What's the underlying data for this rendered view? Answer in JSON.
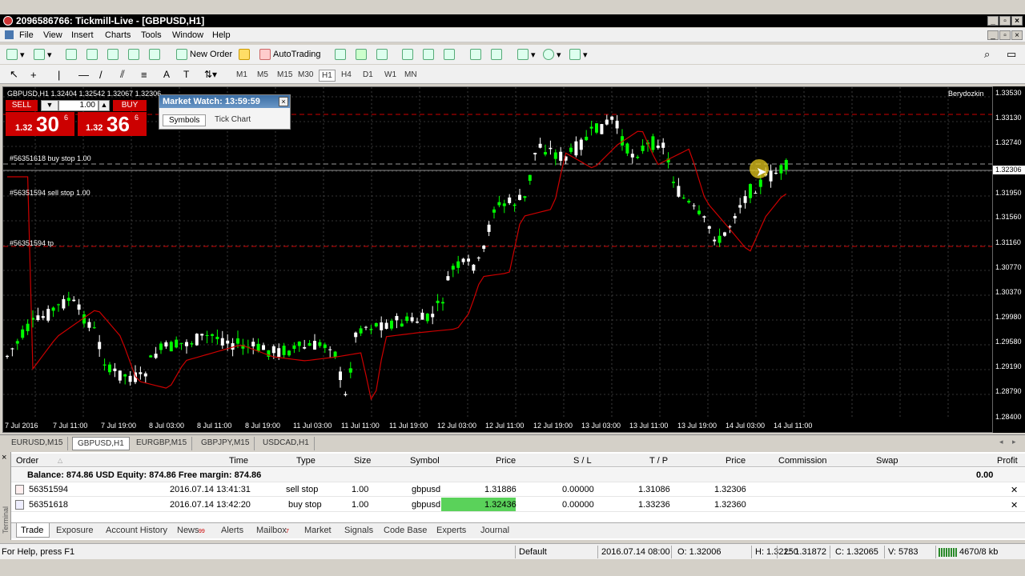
{
  "window": {
    "title": "2096586766: Tickmill-Live - [GBPUSD,H1]"
  },
  "menu": [
    "File",
    "View",
    "Insert",
    "Charts",
    "Tools",
    "Window",
    "Help"
  ],
  "toolbar": {
    "new_order": "New Order",
    "autotrading": "AutoTrading"
  },
  "timeframes": [
    "M1",
    "M5",
    "M15",
    "M30",
    "H1",
    "H4",
    "D1",
    "W1",
    "MN"
  ],
  "timeframe_active": "H1",
  "chart": {
    "header": "GBPUSD,H1  1.32404 1.32542 1.32067 1.32306",
    "corner_label": "Berydozkin",
    "line_labels": {
      "buy_stop": "#56351618 buy stop 1.00",
      "sell_stop": "#56351594 sell stop 1.00",
      "tp": "#56351594 tp"
    },
    "y_ticks": [
      "1.33530",
      "1.33130",
      "1.32740",
      "1.32306",
      "1.31950",
      "1.31560",
      "1.31160",
      "1.30770",
      "1.30370",
      "1.29980",
      "1.29580",
      "1.29190",
      "1.28790",
      "1.28400"
    ],
    "x_ticks": [
      "7 Jul 2016",
      "7 Jul 11:00",
      "7 Jul 19:00",
      "8 Jul 03:00",
      "8 Jul 11:00",
      "8 Jul 19:00",
      "11 Jul 03:00",
      "11 Jul 11:00",
      "11 Jul 19:00",
      "12 Jul 03:00",
      "12 Jul 11:00",
      "12 Jul 19:00",
      "13 Jul 03:00",
      "13 Jul 11:00",
      "13 Jul 19:00",
      "14 Jul 03:00",
      "14 Jul 11:00"
    ],
    "current_price": "1.32306"
  },
  "one_click": {
    "sell_label": "SELL",
    "buy_label": "BUY",
    "lot": "1.00",
    "sell_big": "30",
    "sell_small": "1.32",
    "sell_sup": "6",
    "buy_big": "36",
    "buy_small": "1.32",
    "buy_sup": "6"
  },
  "market_watch": {
    "title": "Market Watch: 13:59:59",
    "tab_symbols": "Symbols",
    "tab_tick": "Tick Chart"
  },
  "chart_tabs": [
    "EURUSD,M15",
    "GBPUSD,H1",
    "EURGBP,M15",
    "GBPJPY,M15",
    "USDCAD,H1"
  ],
  "chart_tab_active": "GBPUSD,H1",
  "terminal": {
    "headers": [
      "Order",
      "Time",
      "Type",
      "Size",
      "Symbol",
      "Price",
      "S / L",
      "T / P",
      "Price",
      "Commission",
      "Swap",
      "Profit"
    ],
    "balance": "Balance: 874.86 USD  Equity: 874.86  Free margin: 874.86",
    "balance_profit": "0.00",
    "rows": [
      {
        "order": "56351594",
        "time": "2016.07.14 13:41:31",
        "type": "sell stop",
        "size": "1.00",
        "symbol": "gbpusd",
        "price": "1.31886",
        "sl": "0.00000",
        "tp": "1.31086",
        "cur": "1.32306"
      },
      {
        "order": "56351618",
        "time": "2016.07.14 13:42:20",
        "type": "buy stop",
        "size": "1.00",
        "symbol": "gbpusd",
        "price": "1.32436",
        "sl": "0.00000",
        "tp": "1.33236",
        "cur": "1.32360"
      }
    ],
    "side_label": "Terminal"
  },
  "bottom_tabs": {
    "trade": "Trade",
    "exposure": "Exposure",
    "history": "Account History",
    "news": "News",
    "news_badge": "99",
    "alerts": "Alerts",
    "mailbox": "Mailbox",
    "mailbox_badge": "7",
    "market": "Market",
    "signals": "Signals",
    "codebase": "Code Base",
    "experts": "Experts",
    "journal": "Journal"
  },
  "status": {
    "help": "For Help, press F1",
    "profile": "Default",
    "datetime": "2016.07.14 08:00",
    "open": "O: 1.32006",
    "high": "H: 1.32250",
    "low": "L: 1.31872",
    "close": "C: 1.32065",
    "volume": "V: 5783",
    "traffic": "4670/8 kb"
  },
  "colors": {
    "bull": "#00ff00",
    "bear": "#ffffff",
    "ma": "#cc0000",
    "stop_line": "#cc0000"
  }
}
